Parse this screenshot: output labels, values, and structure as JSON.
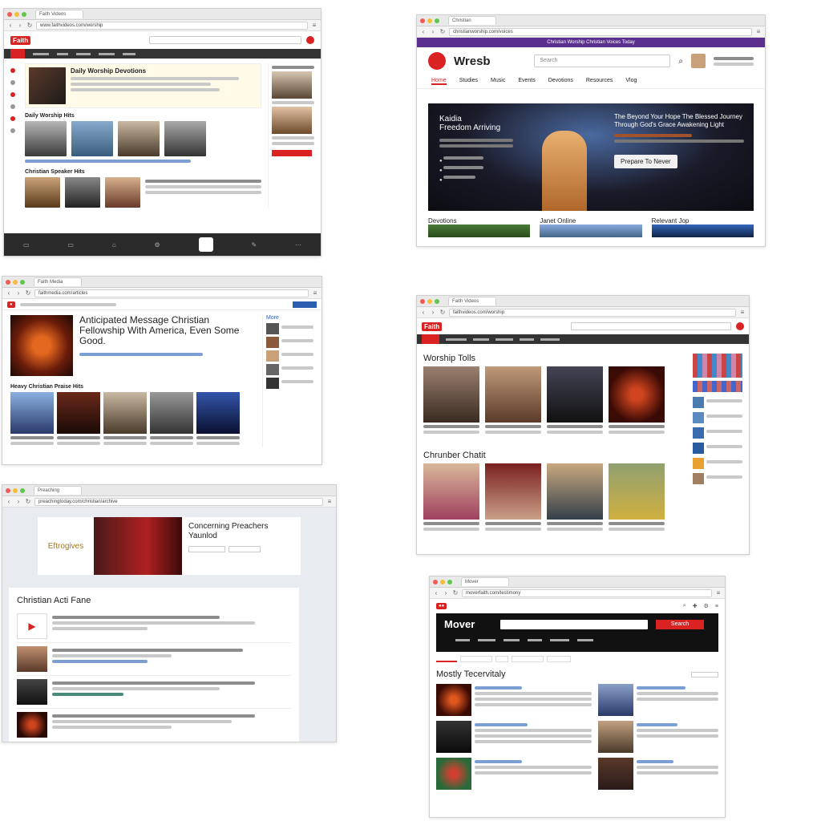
{
  "colors": {
    "brand_red": "#d92323",
    "purple_banner": "#5b2f8e",
    "link_blue": "#2a5db0",
    "dark_bar": "#2b2b2b"
  },
  "w1": {
    "tab": "Faith Videos",
    "url": "www.faithvideos.com/worship",
    "logo": "Faith",
    "feature_title": "Daily Worship Devotions",
    "section1": "Daily Worship Hits",
    "section2": "Christian Speaker Hits"
  },
  "w2": {
    "tab": "Christian",
    "url": "christianworship.com/voices",
    "banner": "Christian Worship Christian Voices Today",
    "logo": "Wresb",
    "search_placeholder": "Search",
    "nav": [
      "Home",
      "Studies",
      "Music",
      "Events",
      "Devotions",
      "Resources",
      "Vlog"
    ],
    "hero_left_title_1": "Kaidia",
    "hero_left_title_2": "Freedom Arriving",
    "hero_right_title": "The Beyond Your Hope The Blessed Journey Through God's Grace Awakening Light",
    "hero_cta": "Prepare To Never",
    "cards": [
      "Devotions",
      "Janet Online",
      "Relevant Jop"
    ]
  },
  "w3": {
    "tab": "Faith Media",
    "url": "faithmedia.com/articles",
    "headline": "Anticipated Message Christian Fellowship With America, Even Some Good.",
    "section": "Heavy Christian Praise Hits",
    "sidebar_title": "More"
  },
  "w4": {
    "tab": "Faith Videos",
    "url": "faithvideos.com/worship",
    "logo": "Faith",
    "section1": "Worship Tolls",
    "section2": "Chrunber Chatit"
  },
  "w5": {
    "tab": "Preaching",
    "url": "preachingtoday.com/christian/archive",
    "brand": "Eftrogives",
    "headline": "Concerning Preachers Yaunlod",
    "section": "Christian Acti Fane"
  },
  "w6": {
    "tab": "Mover",
    "url": "moverfaith.com/testimony",
    "logo": "Mover",
    "search_btn": "Search",
    "section": "Mostly Tecervitaly"
  }
}
